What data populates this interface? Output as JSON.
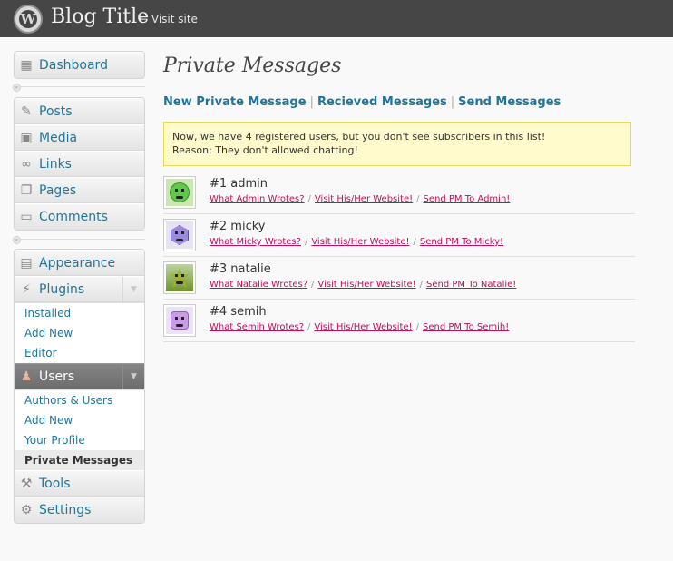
{
  "header": {
    "logo_glyph": "W",
    "blog_title": "Blog Title",
    "visit_site": "← Visit site"
  },
  "sidebar": {
    "dashboard": "Dashboard",
    "posts": "Posts",
    "media": "Media",
    "links": "Links",
    "pages": "Pages",
    "comments": "Comments",
    "appearance": "Appearance",
    "plugins": {
      "label": "Plugins",
      "submenu": [
        "Installed",
        "Add New",
        "Editor"
      ]
    },
    "users": {
      "label": "Users",
      "submenu": [
        "Authors & Users",
        "Add New",
        "Your Profile",
        "Private Messages"
      ]
    },
    "tools": "Tools",
    "settings": "Settings",
    "collapse_glyph": "«",
    "toggle_glyph": "▼"
  },
  "main": {
    "title": "Private Messages",
    "nav": {
      "new_pm": "New Private Message",
      "received": "Recieved Messages",
      "sent": "Send Messages",
      "separator": "|"
    },
    "notice": {
      "line1": "Now, we have 4 registered users, but you don't see subscribers in this list!",
      "line2": "Reason: They don't allowed chatting!"
    },
    "link_separator": "/",
    "users": [
      {
        "name": "#1 admin",
        "wrote": "What Admin Wrotes?",
        "website": "Visit His/Her Website!",
        "send": "Send PM To Admin!"
      },
      {
        "name": "#2 micky",
        "wrote": "What Micky Wrotes?",
        "website": "Visit His/Her Website!",
        "send": "Send PM To Micky!"
      },
      {
        "name": "#3 natalie",
        "wrote": "What Natalie Wrotes?",
        "website": "Visit His/Her Website!",
        "send": "Send PM To Natalie!"
      },
      {
        "name": "#4 semih",
        "wrote": "What Semih Wrotes?",
        "website": "Visit His/Her Website!",
        "send": "Send PM To Semih!"
      }
    ]
  },
  "colors": {
    "header_bg": "#464646",
    "link_blue": "#21759b",
    "user_link": "#c00f5c",
    "notice_bg": "#fffbcc",
    "notice_border": "#e6db55"
  }
}
